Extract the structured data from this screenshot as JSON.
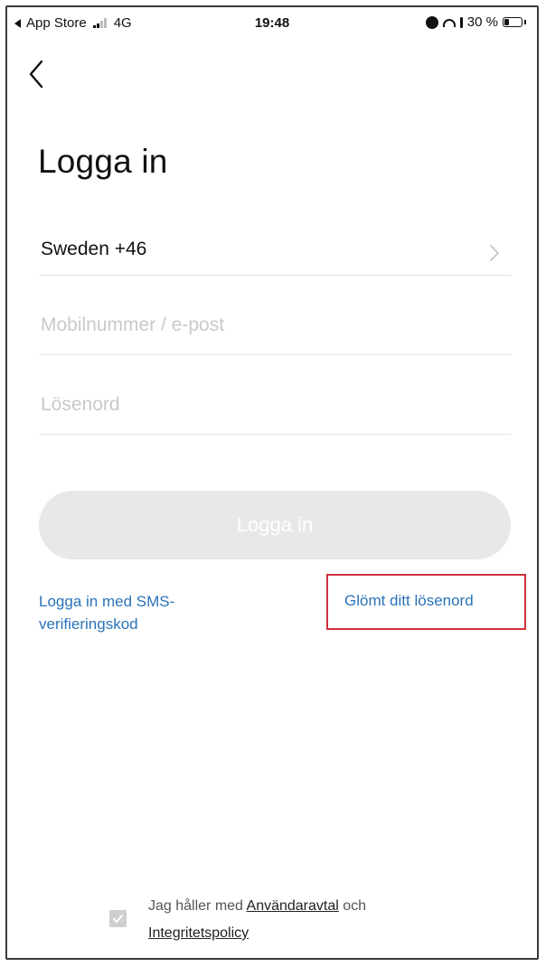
{
  "status_bar": {
    "back_app": "App Store",
    "network": "4G",
    "time": "19:48",
    "battery": "30 %",
    "battery_level": 0.3
  },
  "page": {
    "title": "Logga in"
  },
  "form": {
    "country": "Sweden +46",
    "phone_placeholder": "Mobilnummer / e-post",
    "password_placeholder": "Lösenord",
    "login_button": "Logga in"
  },
  "links": {
    "sms_login": "Logga in med SMS-verifieringskod",
    "forgot_password": "Glömt ditt lösenord"
  },
  "agreement": {
    "prefix": "Jag håller med",
    "user_agreement": "Användaravtal",
    "conjunction": "och",
    "privacy_policy": "Integritetspolicy"
  },
  "colors": {
    "link": "#2a73b8",
    "highlight": "#d0303b",
    "button_disabled": "#e8e8e8"
  },
  "icons": {
    "back": "chevron-left-icon",
    "country_select": "chevron-right-icon",
    "checkbox": "checkbox-icon"
  }
}
